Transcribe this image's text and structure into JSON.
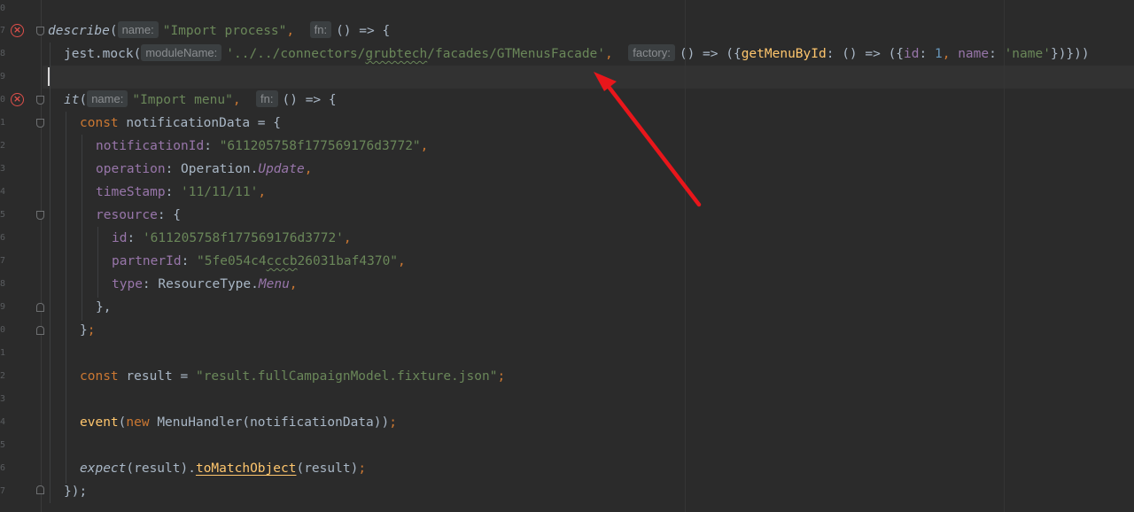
{
  "editor": {
    "hints": {
      "name": "name:",
      "fn": "fn:",
      "moduleName": "moduleName:",
      "factory": "factory:"
    },
    "describe_line": {
      "func": "describe",
      "open_paren": "(",
      "title": "\"Import process\"",
      "comma": ",",
      "arrow": "() => {"
    },
    "mock_line": {
      "obj": "jest.mock(",
      "path_pre": "'../../connectors/",
      "path_squig": "grubtech",
      "path_post": "/facades/GTMenusFacade'",
      "comma": ",",
      "factory_pre": "() => ({",
      "method": "getMenuById",
      "colon": ": () => ({",
      "id_key": "id",
      "colon2": ": ",
      "id_val": "1",
      "comma2": ", ",
      "name_key": "name",
      "colon3": ": ",
      "name_val": "'name'",
      "close": "})}))"
    },
    "it_line": {
      "func": "it",
      "open_paren": "(",
      "title": "\"Import menu\"",
      "comma": ",",
      "arrow": "() => {"
    },
    "const_line": {
      "kw": "const",
      "rest": " notificationData = {"
    },
    "notification_id": {
      "key": "notificationId",
      "colon": ": ",
      "value": "\"611205758f177569176d3772\"",
      "comma": ","
    },
    "operation": {
      "key": "operation",
      "colon": ": Operation.",
      "value": "Update",
      "comma": ","
    },
    "timestamp": {
      "key": "timeStamp",
      "colon": ": ",
      "value": "'11/11/11'",
      "comma": ","
    },
    "resource": {
      "key": "resource",
      "colon": ": {"
    },
    "resource_id": {
      "key": "id",
      "colon": ": ",
      "value": "'611205758f177569176d3772'",
      "comma": ","
    },
    "partner_id": {
      "key": "partnerId",
      "colon": ": ",
      "value_pre": "\"5fe054c4",
      "value_squig": "cccb",
      "value_post": "26031baf4370\"",
      "comma": ","
    },
    "type": {
      "key": "type",
      "colon": ": ResourceType.",
      "value": "Menu",
      "comma": ","
    },
    "close_resource": "},",
    "close_const": "}",
    "close_const_semi": ";",
    "result_line": {
      "kw": "const",
      "rest": " result = ",
      "value": "\"result.fullCampaignModel.fixture.json\"",
      "semi": ";"
    },
    "event_line": {
      "func": "event",
      "open": "(",
      "kw": "new",
      "rest": " MenuHandler(notificationData))",
      "semi": ";"
    },
    "expect_line": {
      "func": "expect",
      "mid": "(result).",
      "method": "toMatchObject",
      "rest": "(result)",
      "semi": ";"
    },
    "close_describe": "});"
  },
  "annotation": {
    "arrow_color": "#e8161b"
  }
}
